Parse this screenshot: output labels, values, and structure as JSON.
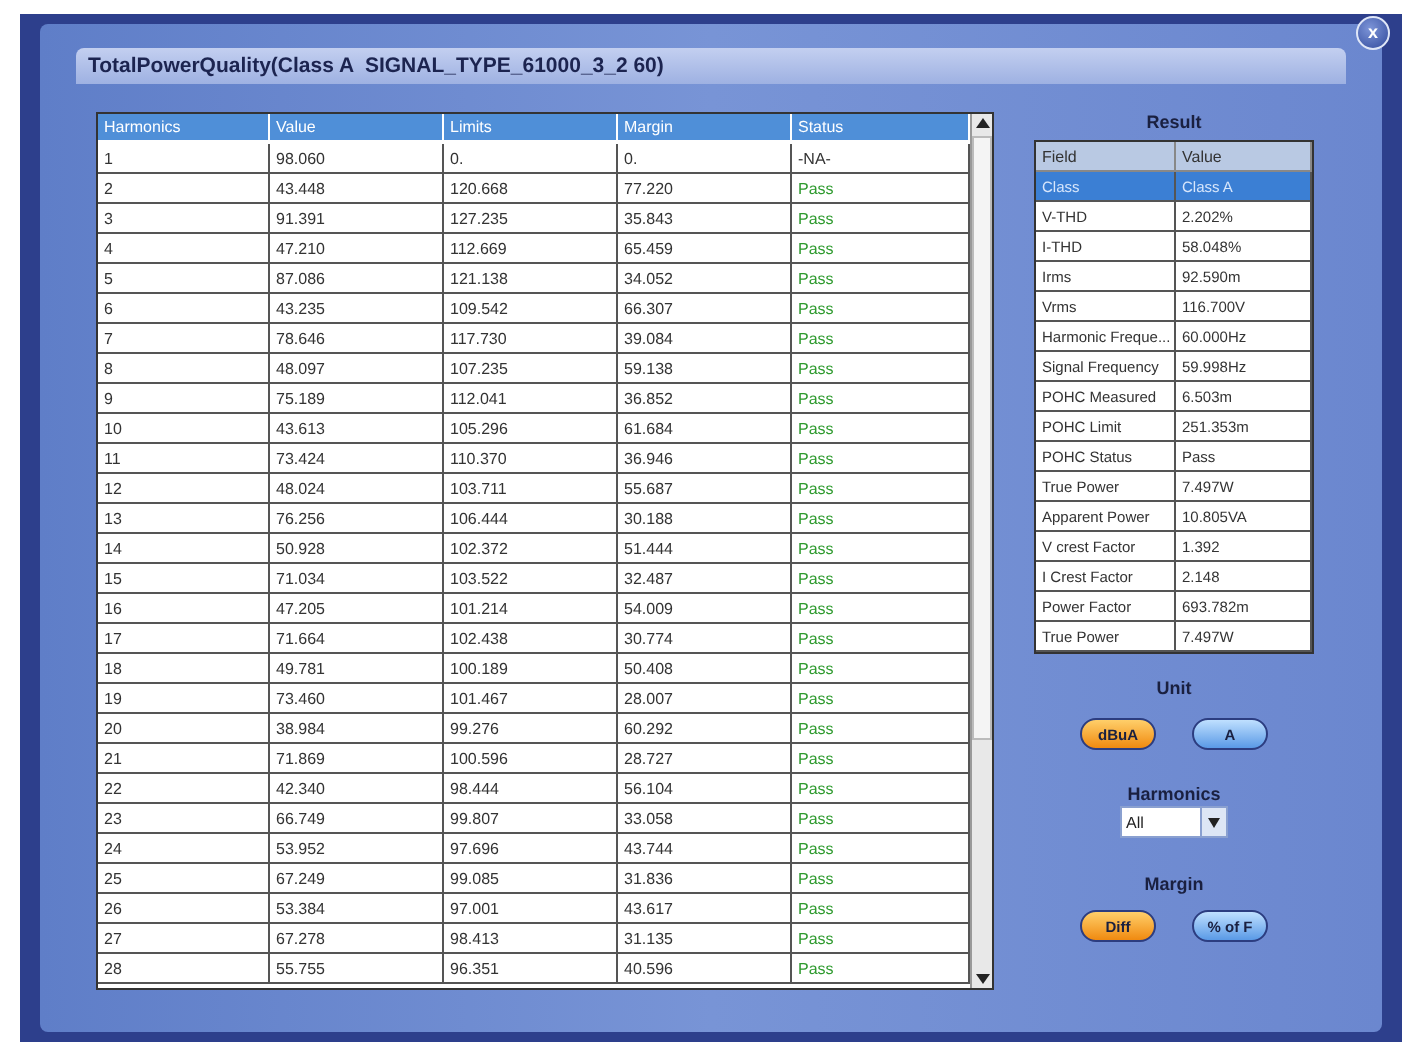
{
  "window": {
    "title": "TotalPowerQuality(Class A  SIGNAL_TYPE_61000_3_2 60)",
    "close": "x"
  },
  "harmonics_table": {
    "columns": [
      "Harmonics",
      "Value",
      "Limits",
      "Margin",
      "Status"
    ],
    "rows": [
      {
        "cells": [
          "1",
          "98.060",
          " 0.",
          " 0.",
          "-NA-"
        ],
        "pass": false
      },
      {
        "cells": [
          "2",
          "43.448",
          "120.668",
          "77.220",
          "Pass"
        ],
        "pass": true
      },
      {
        "cells": [
          "3",
          "91.391",
          "127.235",
          "35.843",
          "Pass"
        ],
        "pass": true
      },
      {
        "cells": [
          "4",
          "47.210",
          "112.669",
          "65.459",
          "Pass"
        ],
        "pass": true
      },
      {
        "cells": [
          "5",
          "87.086",
          "121.138",
          "34.052",
          "Pass"
        ],
        "pass": true
      },
      {
        "cells": [
          "6",
          "43.235",
          "109.542",
          "66.307",
          "Pass"
        ],
        "pass": true
      },
      {
        "cells": [
          "7",
          "78.646",
          "117.730",
          "39.084",
          "Pass"
        ],
        "pass": true
      },
      {
        "cells": [
          "8",
          "48.097",
          "107.235",
          "59.138",
          "Pass"
        ],
        "pass": true
      },
      {
        "cells": [
          "9",
          "75.189",
          "112.041",
          "36.852",
          "Pass"
        ],
        "pass": true
      },
      {
        "cells": [
          "10",
          "43.613",
          "105.296",
          "61.684",
          "Pass"
        ],
        "pass": true
      },
      {
        "cells": [
          "11",
          "73.424",
          "110.370",
          "36.946",
          "Pass"
        ],
        "pass": true
      },
      {
        "cells": [
          "12",
          "48.024",
          "103.711",
          "55.687",
          "Pass"
        ],
        "pass": true
      },
      {
        "cells": [
          "13",
          "76.256",
          "106.444",
          "30.188",
          "Pass"
        ],
        "pass": true
      },
      {
        "cells": [
          "14",
          "50.928",
          "102.372",
          "51.444",
          "Pass"
        ],
        "pass": true
      },
      {
        "cells": [
          "15",
          "71.034",
          "103.522",
          "32.487",
          "Pass"
        ],
        "pass": true
      },
      {
        "cells": [
          "16",
          "47.205",
          "101.214",
          "54.009",
          "Pass"
        ],
        "pass": true
      },
      {
        "cells": [
          "17",
          "71.664",
          "102.438",
          "30.774",
          "Pass"
        ],
        "pass": true
      },
      {
        "cells": [
          "18",
          "49.781",
          "100.189",
          "50.408",
          "Pass"
        ],
        "pass": true
      },
      {
        "cells": [
          "19",
          "73.460",
          "101.467",
          "28.007",
          "Pass"
        ],
        "pass": true
      },
      {
        "cells": [
          "20",
          "38.984",
          "99.276",
          "60.292",
          "Pass"
        ],
        "pass": true
      },
      {
        "cells": [
          "21",
          "71.869",
          "100.596",
          "28.727",
          "Pass"
        ],
        "pass": true
      },
      {
        "cells": [
          "22",
          "42.340",
          "98.444",
          "56.104",
          "Pass"
        ],
        "pass": true
      },
      {
        "cells": [
          "23",
          "66.749",
          "99.807",
          "33.058",
          "Pass"
        ],
        "pass": true
      },
      {
        "cells": [
          "24",
          "53.952",
          "97.696",
          "43.744",
          "Pass"
        ],
        "pass": true
      },
      {
        "cells": [
          "25",
          "67.249",
          "99.085",
          "31.836",
          "Pass"
        ],
        "pass": true
      },
      {
        "cells": [
          "26",
          "53.384",
          "97.001",
          "43.617",
          "Pass"
        ],
        "pass": true
      },
      {
        "cells": [
          "27",
          "67.278",
          "98.413",
          "31.135",
          "Pass"
        ],
        "pass": true
      },
      {
        "cells": [
          "28",
          "55.755",
          "96.351",
          "40.596",
          "Pass"
        ],
        "pass": true
      }
    ]
  },
  "result": {
    "title": "Result",
    "columns": [
      "Field",
      "Value"
    ],
    "rows": [
      {
        "field": "Class",
        "value": "Class A",
        "selected": true
      },
      {
        "field": "V-THD",
        "value": "2.202%",
        "selected": false
      },
      {
        "field": "I-THD",
        "value": "58.048%",
        "selected": false
      },
      {
        "field": "Irms",
        "value": "92.590m",
        "selected": false
      },
      {
        "field": "Vrms",
        "value": "116.700V",
        "selected": false
      },
      {
        "field": "Harmonic Freque...",
        "value": "60.000Hz",
        "selected": false
      },
      {
        "field": "Signal Frequency",
        "value": "59.998Hz",
        "selected": false
      },
      {
        "field": "POHC Measured",
        "value": "6.503m",
        "selected": false
      },
      {
        "field": "POHC Limit",
        "value": "251.353m",
        "selected": false
      },
      {
        "field": "POHC Status",
        "value": "Pass",
        "selected": false
      },
      {
        "field": "True Power",
        "value": "7.497W",
        "selected": false
      },
      {
        "field": "Apparent Power",
        "value": "10.805VA",
        "selected": false
      },
      {
        "field": "V crest Factor",
        "value": "1.392",
        "selected": false
      },
      {
        "field": "I Crest Factor",
        "value": "2.148",
        "selected": false
      },
      {
        "field": "Power Factor",
        "value": "693.782m",
        "selected": false
      },
      {
        "field": "True Power",
        "value": "7.497W",
        "selected": false
      }
    ]
  },
  "unit": {
    "label": "Unit",
    "options": [
      {
        "label": "dBuA",
        "selected": true
      },
      {
        "label": "A",
        "selected": false
      }
    ]
  },
  "harmonics_filter": {
    "label": "Harmonics",
    "value": "All"
  },
  "margin": {
    "label": "Margin",
    "options": [
      {
        "label": "Diff",
        "selected": true
      },
      {
        "label": "% of F",
        "selected": false
      }
    ]
  }
}
